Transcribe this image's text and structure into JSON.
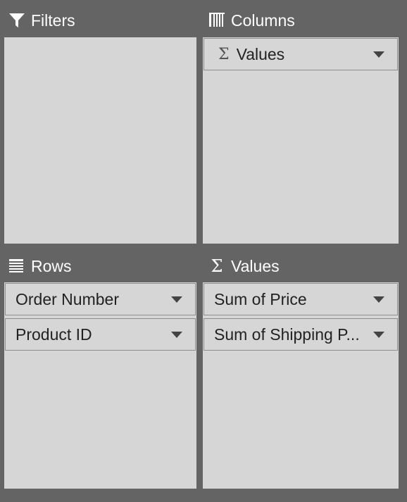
{
  "areas": {
    "filters": {
      "title": "Filters",
      "icon": "filter-icon",
      "items": []
    },
    "columns": {
      "title": "Columns",
      "icon": "columns-icon",
      "items": [
        {
          "label": "Values",
          "icon": "sigma-icon",
          "symbol": "Σ"
        }
      ]
    },
    "rows": {
      "title": "Rows",
      "icon": "rows-icon",
      "items": [
        {
          "label": "Order Number"
        },
        {
          "label": "Product ID"
        }
      ]
    },
    "values": {
      "title": "Values",
      "icon": "sigma-icon",
      "symbol": "Σ",
      "items": [
        {
          "label": "Sum of Price"
        },
        {
          "label": "Sum of Shipping P..."
        }
      ]
    }
  },
  "colors": {
    "background": "#646464",
    "panel": "#d6d6d6",
    "item_border": "#8e8e8e",
    "header_text": "#ffffff",
    "item_text": "#222222"
  }
}
